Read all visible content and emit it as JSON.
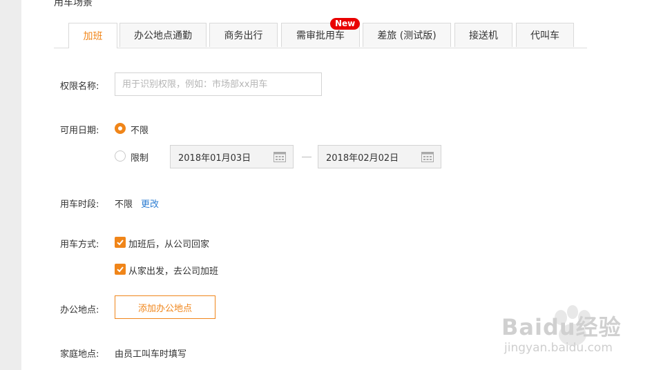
{
  "section": {
    "title": "用车场景"
  },
  "tabs": [
    {
      "label": "加班",
      "active": true
    },
    {
      "label": "办公地点通勤"
    },
    {
      "label": "商务出行"
    },
    {
      "label": "需审批用车",
      "badge": "New"
    },
    {
      "label": "差旅 (测试版)"
    },
    {
      "label": "接送机"
    },
    {
      "label": "代叫车"
    }
  ],
  "form": {
    "perm_name": {
      "label": "权限名称:",
      "placeholder": "用于识别权限，例如：市场部xx用车",
      "value": ""
    },
    "avail_date": {
      "label": "可用日期:",
      "option_unlimited": "不限",
      "option_limited": "限制",
      "selected": "不限",
      "start_date": "2018年01月03日",
      "end_date": "2018年02月02日"
    },
    "time_period": {
      "label": "用车时段:",
      "value": "不限",
      "change_link": "更改"
    },
    "usage_mode": {
      "label": "用车方式:",
      "options": [
        {
          "label": "加班后，从公司回家",
          "checked": true
        },
        {
          "label": "从家出发，去公司加班",
          "checked": true
        }
      ]
    },
    "office": {
      "label": "办公地点:",
      "button": "添加办公地点"
    },
    "home": {
      "label": "家庭地点:",
      "value": "由员工叫车时填写"
    }
  },
  "watermark": {
    "text": "Baidu经验",
    "sub": "jingyan.baidu.com"
  },
  "colors": {
    "accent": "#f08519",
    "link": "#2d7dd2",
    "badge": "#e90000"
  }
}
